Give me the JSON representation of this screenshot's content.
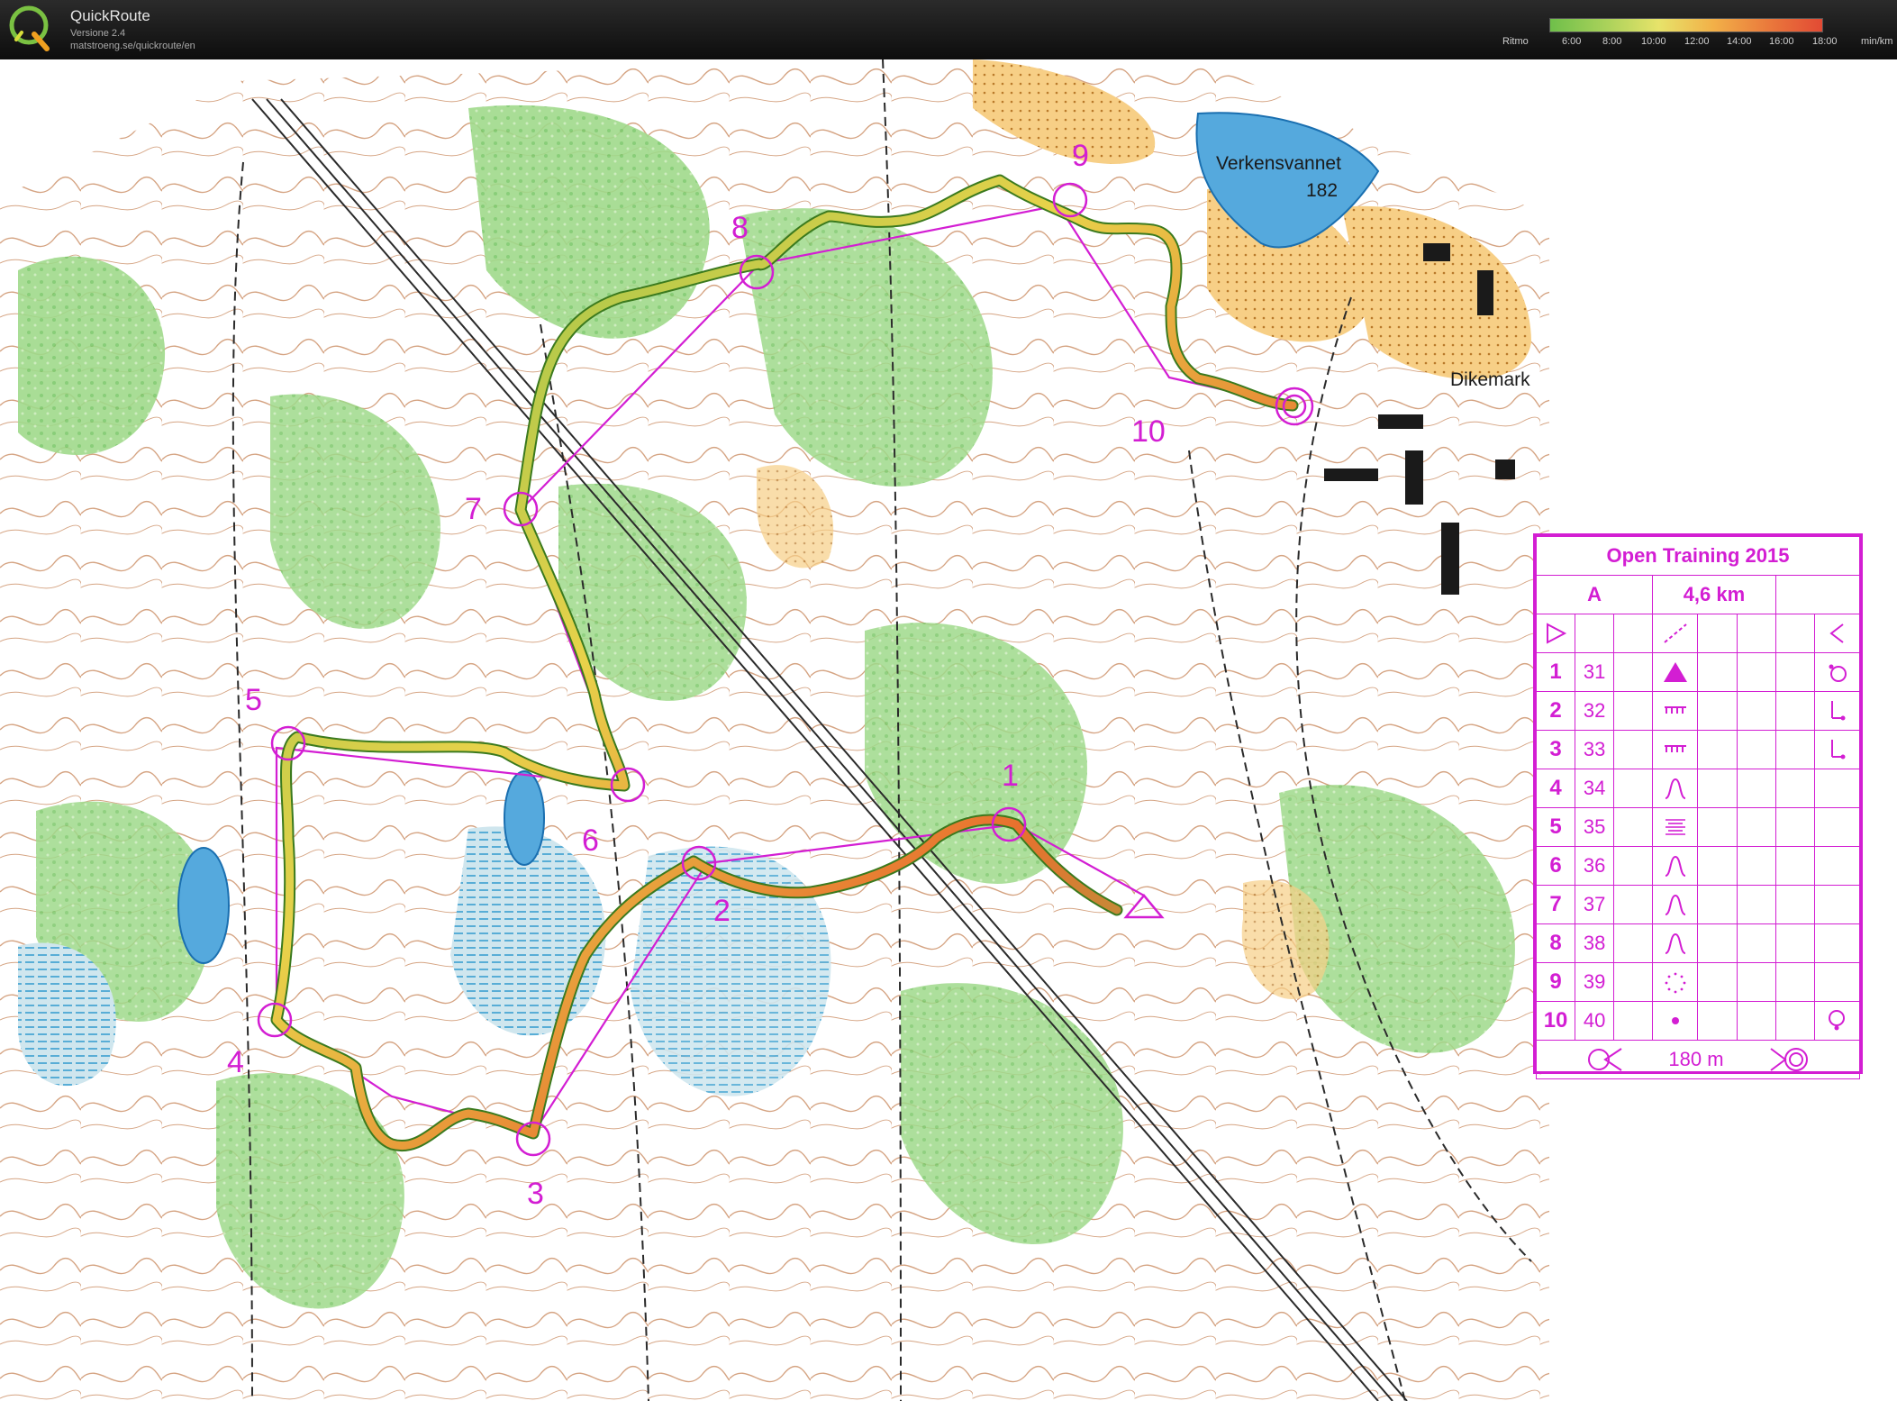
{
  "app": {
    "title": "QuickRoute",
    "version": "Versione 2.4",
    "url": "matstroeng.se/quickroute/en"
  },
  "pace_legend": {
    "label": "Ritmo",
    "ticks": [
      "6:00",
      "8:00",
      "10:00",
      "12:00",
      "14:00",
      "16:00",
      "18:00"
    ],
    "unit": "min/km",
    "colors": [
      "#6fbf4a",
      "#a8d15a",
      "#e7e36a",
      "#f2b048",
      "#ea7a3c",
      "#e24a34"
    ]
  },
  "map": {
    "lake_name": "Verkensvannet",
    "lake_height": "182",
    "place_name": "Dikemark",
    "course_color": "#d31ed3",
    "controls": [
      {
        "label": "1"
      },
      {
        "label": "2"
      },
      {
        "label": "3"
      },
      {
        "label": "4"
      },
      {
        "label": "5"
      },
      {
        "label": "6"
      },
      {
        "label": "7"
      },
      {
        "label": "8"
      },
      {
        "label": "9"
      },
      {
        "label": "10"
      }
    ]
  },
  "description_sheet": {
    "title": "Open Training 2015",
    "class": "A",
    "length": "4,6 km",
    "rows": [
      {
        "num": "1",
        "code": "31",
        "feature": "triangle-solid-icon",
        "detail": "circle-tl-icon"
      },
      {
        "num": "2",
        "code": "32",
        "feature": "wall-icon",
        "detail": "foot-icon"
      },
      {
        "num": "3",
        "code": "33",
        "feature": "wall-icon",
        "detail": "foot-icon"
      },
      {
        "num": "4",
        "code": "34",
        "feature": "knoll-icon",
        "detail": ""
      },
      {
        "num": "5",
        "code": "35",
        "feature": "marsh-icon",
        "detail": ""
      },
      {
        "num": "6",
        "code": "36",
        "feature": "knoll-icon",
        "detail": ""
      },
      {
        "num": "7",
        "code": "37",
        "feature": "knoll-icon",
        "detail": ""
      },
      {
        "num": "8",
        "code": "38",
        "feature": "knoll-icon",
        "detail": ""
      },
      {
        "num": "9",
        "code": "39",
        "feature": "depression-dotted-icon",
        "detail": ""
      },
      {
        "num": "10",
        "code": "40",
        "feature": "dot-icon",
        "detail": "circle-bottom-icon"
      }
    ],
    "finish_distance": "180 m"
  }
}
